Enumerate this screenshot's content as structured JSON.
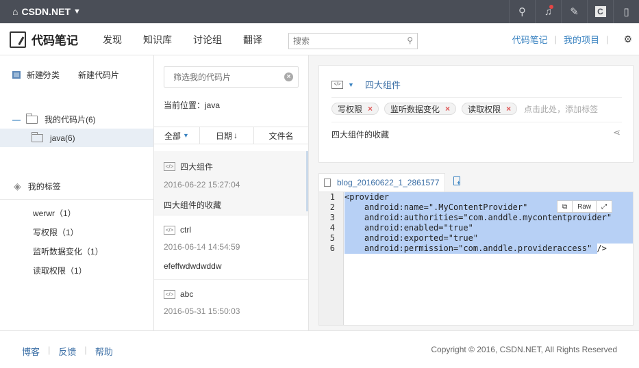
{
  "topbar": {
    "brand": "CSDN.NET",
    "icons": [
      "search-icon",
      "bell-icon",
      "pen-icon",
      "c-icon",
      "phone-icon"
    ]
  },
  "header": {
    "logo_text": "代码笔记",
    "nav": [
      "发现",
      "知识库",
      "讨论组",
      "翻译"
    ],
    "search_placeholder": "搜索",
    "links": [
      "代码笔记",
      "我的项目"
    ]
  },
  "sidebar": {
    "new_category": "新建分类",
    "new_snippet": "新建代码片",
    "tree": [
      {
        "label": "我的代码片(6)"
      },
      {
        "label": "java(6)"
      }
    ],
    "tags_title": "我的标签",
    "tags": [
      "werwr（1）",
      "写权限（1）",
      "监听数据变化（1）",
      "读取权限（1）"
    ]
  },
  "middle": {
    "filter_placeholder": "筛选我的代码片",
    "current_position": "当前位置：java",
    "sort": [
      "全部",
      "日期",
      "文件名"
    ],
    "cards": [
      {
        "title": "四大组件",
        "date": "2016-06-22 15:27:04",
        "desc": "四大组件的收藏"
      },
      {
        "title": "ctrl",
        "date": "2016-06-14 14:54:59",
        "desc": "efeffwdwdwddw"
      },
      {
        "title": "abc",
        "date": "2016-05-31 15:50:03",
        "desc": ""
      }
    ]
  },
  "detail": {
    "title": "四大组件",
    "tags": [
      "写权限",
      "监听数据变化",
      "读取权限"
    ],
    "add_tag_hint": "点击此处，添加标签",
    "description": "四大组件的收藏",
    "file_tab": "blog_20160622_1_2861577",
    "code_tools": [
      "Raw"
    ],
    "code_lines": [
      "<provider",
      "    android:name=\".MyContentProvider\"",
      "    android:authorities=\"com.anddle.mycontentprovider\"",
      "    android:enabled=\"true\"",
      "    android:exported=\"true\"",
      "    android:permission=\"com.anddle.provideraccess\" />"
    ]
  },
  "footer": {
    "links": [
      "博客",
      "反馈",
      "帮助"
    ],
    "copyright": "Copyright © 2016, CSDN.NET, All Rights Reserved"
  }
}
